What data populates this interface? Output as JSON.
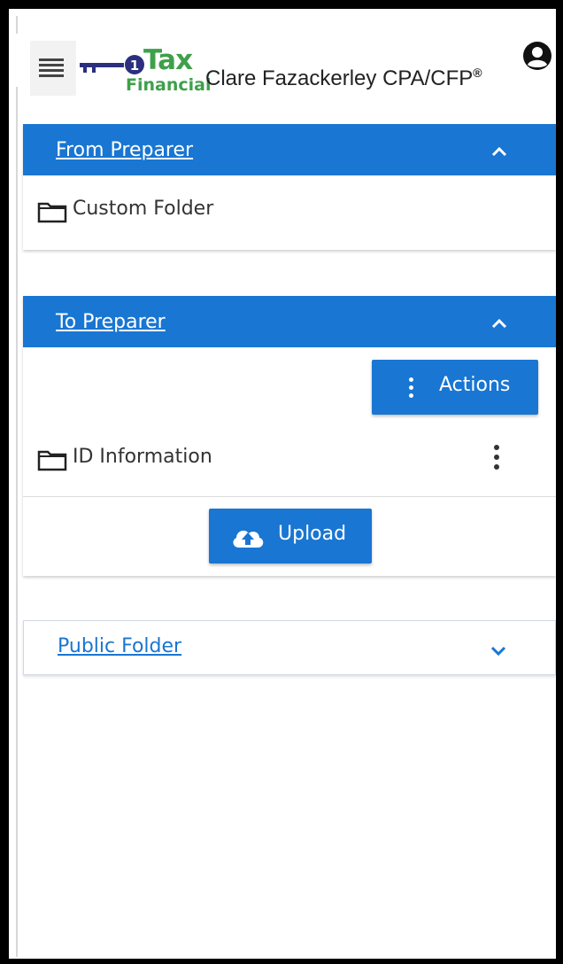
{
  "header": {
    "logo": {
      "word_top": "Tax",
      "word_bottom": "Financial",
      "brand_color": "#3ea04a"
    },
    "firm_name": "Clare Fazackerley CPA/CFP",
    "firm_name_mark": "®",
    "menu_icon": "hamburger-icon",
    "user_icon": "account-circle-icon"
  },
  "sections": {
    "from_preparer": {
      "title": "From Preparer",
      "expanded": true,
      "folders": [
        {
          "label": "Custom Folder",
          "icon": "folder-icon"
        }
      ]
    },
    "to_preparer": {
      "title": "To Preparer",
      "expanded": true,
      "actions_label": "Actions",
      "folders": [
        {
          "label": "ID Information",
          "icon": "folder-icon"
        }
      ],
      "upload_label": "Upload"
    },
    "public_folder": {
      "title": "Public Folder",
      "expanded": false
    }
  },
  "colors": {
    "primary": "#1976d2",
    "header_text": "#222222",
    "frame": "#000000"
  }
}
